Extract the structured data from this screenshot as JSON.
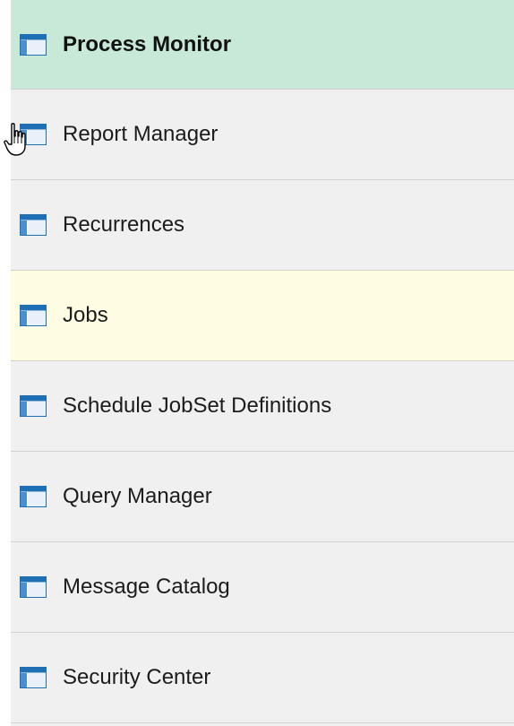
{
  "nav": {
    "items": [
      {
        "label": "Process Monitor",
        "state": "selected",
        "icon": "page-icon"
      },
      {
        "label": "Report Manager",
        "state": "normal",
        "icon": "page-icon"
      },
      {
        "label": "Recurrences",
        "state": "normal",
        "icon": "page-icon"
      },
      {
        "label": "Jobs",
        "state": "hover",
        "icon": "page-icon"
      },
      {
        "label": "Schedule JobSet Definitions",
        "state": "normal",
        "icon": "page-icon"
      },
      {
        "label": "Query Manager",
        "state": "normal",
        "icon": "page-icon"
      },
      {
        "label": "Message Catalog",
        "state": "normal",
        "icon": "page-icon"
      },
      {
        "label": "Security Center",
        "state": "normal",
        "icon": "page-icon"
      }
    ]
  },
  "colors": {
    "selected_background": "#c9e9d8",
    "hover_background": "#fefce3",
    "item_background": "#f0f0f0",
    "divider": "#d1d1d1",
    "icon_blue": "#1f6fb4"
  },
  "cursor": {
    "icon": "hand-pointer-icon"
  }
}
